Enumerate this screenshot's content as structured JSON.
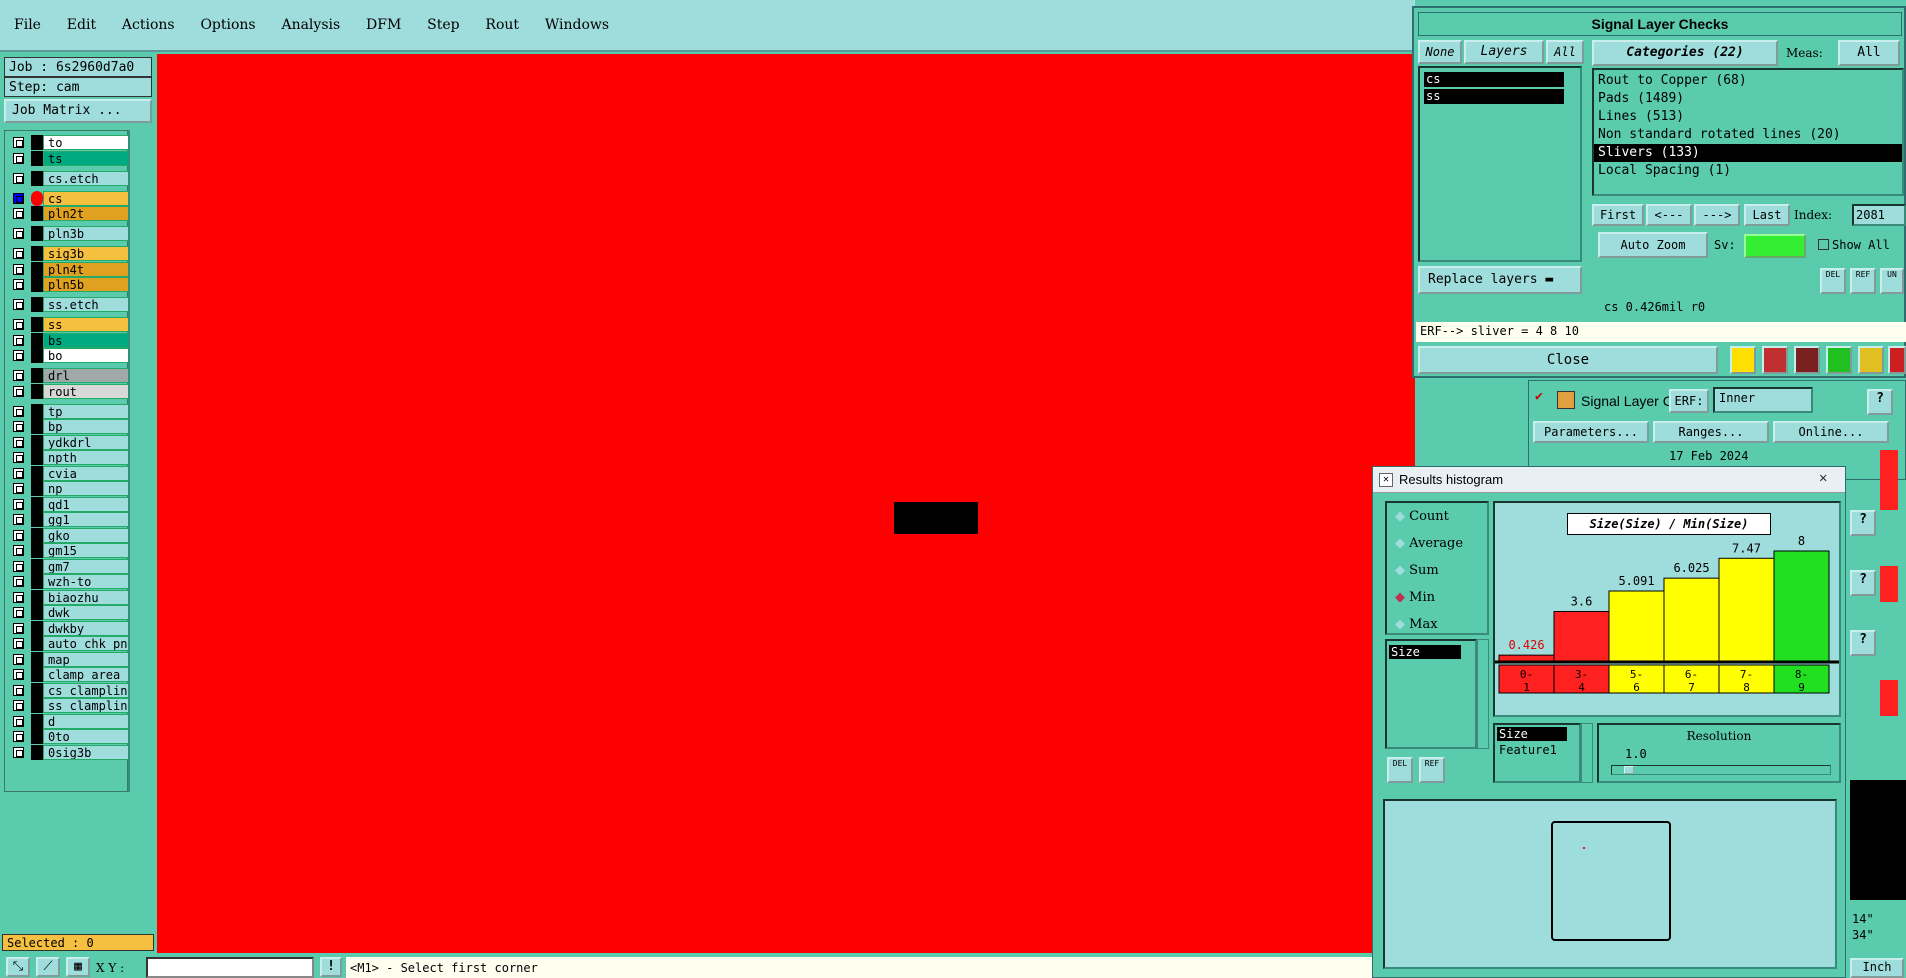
{
  "menu": [
    "File",
    "Edit",
    "Actions",
    "Options",
    "Analysis",
    "DFM",
    "Step",
    "Rout",
    "Windows"
  ],
  "job": {
    "label": "Job : 6s2960d7a0",
    "step": "Step: cam",
    "matrix_button": "Job Matrix ..."
  },
  "layers": [
    {
      "name": "to",
      "color": "#ffffff"
    },
    {
      "name": "ts",
      "color": "#00aa80"
    },
    {
      "name": "cs.etch",
      "color": "#9fdcdc"
    },
    {
      "name": "cs",
      "color": "#f5c040"
    },
    {
      "name": "pln2t",
      "color": "#e0a020"
    },
    {
      "name": "pln3b",
      "color": "#9fdcdc"
    },
    {
      "name": "sig3b",
      "color": "#f5c040"
    },
    {
      "name": "pln4t",
      "color": "#e0a020"
    },
    {
      "name": "pln5b",
      "color": "#e0a020"
    },
    {
      "name": "ss.etch",
      "color": "#9fdcdc"
    },
    {
      "name": "ss",
      "color": "#f5c040"
    },
    {
      "name": "bs",
      "color": "#00aa80"
    },
    {
      "name": "bo",
      "color": "#ffffff"
    },
    {
      "name": "drl",
      "color": "#a0a8a8"
    },
    {
      "name": "rout",
      "color": "#d8d8d8"
    },
    {
      "name": "tp",
      "color": "#9fdcdc"
    },
    {
      "name": "bp",
      "color": "#9fdcdc"
    },
    {
      "name": "ydkdrl",
      "color": "#9fdcdc"
    },
    {
      "name": "npth",
      "color": "#9fdcdc"
    },
    {
      "name": "cvia",
      "color": "#9fdcdc"
    },
    {
      "name": "np",
      "color": "#9fdcdc"
    },
    {
      "name": "qd1",
      "color": "#9fdcdc"
    },
    {
      "name": "gg1",
      "color": "#9fdcdc"
    },
    {
      "name": "gko",
      "color": "#9fdcdc"
    },
    {
      "name": "gm15",
      "color": "#9fdcdc"
    },
    {
      "name": "gm7",
      "color": "#9fdcdc"
    },
    {
      "name": "wzh-to",
      "color": "#9fdcdc"
    },
    {
      "name": "biaozhu",
      "color": "#9fdcdc"
    },
    {
      "name": "dwk",
      "color": "#9fdcdc"
    },
    {
      "name": "dwkby",
      "color": "#9fdcdc"
    },
    {
      "name": "auto_chk_pn",
      "color": "#9fdcdc"
    },
    {
      "name": "map",
      "color": "#9fdcdc"
    },
    {
      "name": "clamp_area",
      "color": "#9fdcdc"
    },
    {
      "name": "cs_clampline",
      "color": "#9fdcdc"
    },
    {
      "name": "ss_clampline",
      "color": "#9fdcdc"
    },
    {
      "name": "d",
      "color": "#9fdcdc"
    },
    {
      "name": "0to",
      "color": "#9fdcdc"
    },
    {
      "name": "0sig3b",
      "color": "#9fdcdc"
    }
  ],
  "selected": "Selected : 0",
  "status": {
    "xy_label": "X Y :",
    "message": "<M1> - Select first corner"
  },
  "slc": {
    "title": "Signal Layer Checks",
    "none": "None",
    "layers": "Layers",
    "all": "All",
    "layer_list": [
      "cs",
      "ss"
    ],
    "categories_btn": "Categories (22)",
    "meas": "Meas:",
    "meas_all": "All",
    "categories": [
      "Rout to Copper (68)",
      "Pads (1489)",
      "Lines (513)",
      "Non standard rotated lines (20)",
      "Slivers (133)",
      "Local Spacing (1)"
    ],
    "first": "First",
    "prev": "<---",
    "next": "--->",
    "last": "Last",
    "index_label": "Index:",
    "index_value": "2081",
    "auto_zoom": "Auto Zoom",
    "sv": "Sv:",
    "show_all": "Show All",
    "replace": "Replace layers",
    "info": "cs 0.426mil  r0",
    "erf": "ERF--> sliver = 4 8 10",
    "close": "Close"
  },
  "slc2": {
    "title": "Signal Layer Ch",
    "erf": "ERF:",
    "erf_value": "Inner",
    "parameters": "Parameters...",
    "ranges": "Ranges...",
    "online": "Online...",
    "date": "17 Feb 2024"
  },
  "hist": {
    "title": "Results histogram",
    "options": [
      "Count",
      "Average",
      "Sum",
      "Min",
      "Max"
    ],
    "selected_option": "Min",
    "chart_title": "Size(Size) / Min(Size)",
    "list1": [
      "Size"
    ],
    "list2": [
      "Size",
      "Feature1"
    ],
    "resolution": "Resolution",
    "resolution_value": "1.0"
  },
  "chart_data": {
    "type": "bar",
    "title": "Size(Size) / Min(Size)",
    "categories": [
      "0-1",
      "3-4",
      "5-6",
      "6-7",
      "7-8",
      "8-9"
    ],
    "values": [
      0.426,
      3.6,
      5.091,
      6.025,
      7.47,
      8
    ],
    "value_labels": [
      "0.426",
      "3.6",
      "5.091",
      "6.025",
      "7.47",
      "8"
    ],
    "colors": [
      "#ff2020",
      "#ff2020",
      "#ffff00",
      "#ffff00",
      "#ffff00",
      "#20e020"
    ],
    "ylim": [
      0,
      8
    ]
  },
  "right_edge": {
    "units": "Inch",
    "v1": "14\"",
    "v2": "34\""
  }
}
